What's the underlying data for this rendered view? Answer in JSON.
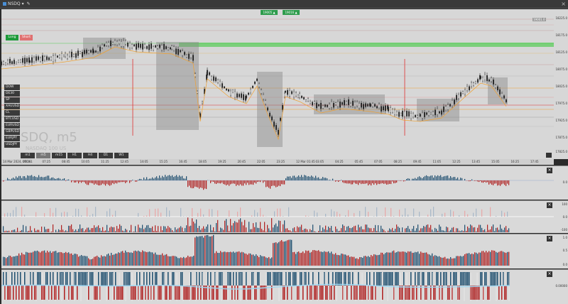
{
  "toolbar": {
    "symbol": "NSDQ",
    "symbol_arrow": "▾",
    "tool_icon": "✎",
    "close_glyph": "×"
  },
  "chart": {
    "watermark_symbol": "SDQ, m5",
    "watermark_name": "NASDAQ 100 US",
    "top_tags": [
      "19005 ▲",
      "19016 ▲"
    ],
    "long_label": "Long",
    "short_label": "Short",
    "right_tag": "19001.0"
  },
  "symbols": [
    "DOW",
    "DE30",
    "SP",
    "XAUUSD",
    "CL",
    "BTCUSD",
    "EURUSD",
    "GBPUSD",
    "EURJPY",
    "USDJPY"
  ],
  "timeframes": [
    "m1",
    "m5",
    "m15",
    "H1",
    "H4",
    "D1",
    "W1"
  ],
  "active_timeframe": "m5",
  "price_axis": [
    "18225.0",
    "18175.0",
    "18125.0",
    "18075.0",
    "18025.0",
    "17975.0",
    "17925.0",
    "17875.0",
    "17825.0"
  ],
  "time_axis": [
    "14 Mar 2024, UTC+1",
    "06:05",
    "07:25",
    "08:45",
    "10:05",
    "11:25",
    "12:45",
    "14:05",
    "15:25",
    "16:45",
    "18:05",
    "19:25",
    "20:45",
    "22:05",
    "23:25",
    "12 Mar 01:45",
    "03:05",
    "04:25",
    "05:45",
    "07:05",
    "08:25",
    "09:45",
    "11:05",
    "12:25",
    "13:45",
    "15:05",
    "16:25",
    "17:45"
  ],
  "panels": [
    {
      "name": "oscillator-1",
      "axis": [
        "",
        "0.0",
        ""
      ]
    },
    {
      "name": "oscillator-2",
      "axis": [
        "100",
        "0.0",
        "-100"
      ]
    },
    {
      "name": "oscillator-3",
      "axis": [
        "1.0",
        "0.5",
        "0.0"
      ]
    },
    {
      "name": "oscillator-4",
      "axis": [
        "",
        "0.00000",
        ""
      ]
    }
  ],
  "colors": {
    "bg": "#d7d7d7",
    "candle": "#222222",
    "red_line": "#e03030",
    "green_zone": "#55cc55",
    "orange_line": "#f0a030",
    "bull_hist": "#1f4f6f",
    "bear_hist": "#b02020"
  }
}
